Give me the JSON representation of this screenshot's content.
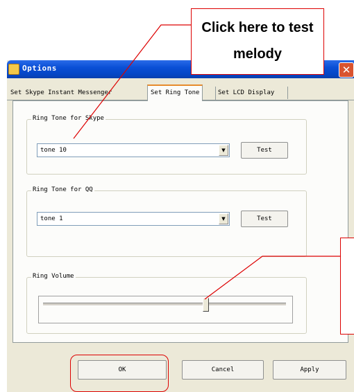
{
  "window": {
    "title": "Options",
    "close_glyph": "✕"
  },
  "tabs": [
    {
      "label": "Set Skype Instant Messenger",
      "selected": false
    },
    {
      "label": "Set Ring Tone",
      "selected": true
    },
    {
      "label": "Set LCD Display",
      "selected": false
    }
  ],
  "skype_group": {
    "label": "Ring Tone for Skype",
    "selected": "tone 10",
    "test_label": "Test"
  },
  "qq_group": {
    "label": "Ring Tone for QQ",
    "selected": "tone 1",
    "test_label": "Test"
  },
  "volume_group": {
    "label": "Ring Volume",
    "level": 0.67
  },
  "footer": {
    "ok_label": "OK",
    "cancel_label": "Cancel",
    "apply_label": "Apply"
  },
  "annotations": {
    "melody_callout": "Click here to test melody",
    "accent_color": "#dd0000"
  },
  "icons": {
    "title_icon": "options-app-icon",
    "combo_arrow": "▼"
  }
}
